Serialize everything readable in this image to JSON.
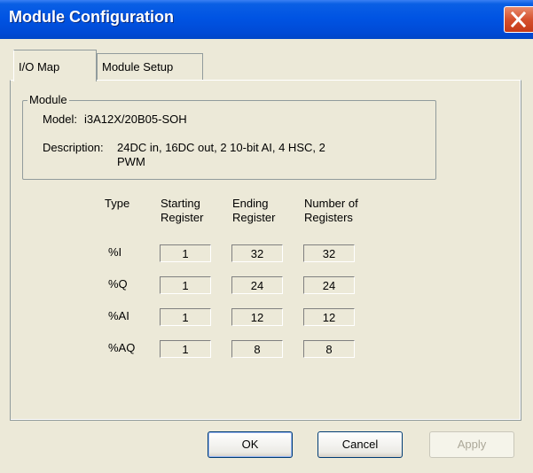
{
  "window": {
    "title": "Module Configuration"
  },
  "tabs": [
    {
      "label": "I/O Map",
      "active": true
    },
    {
      "label": "Module Setup",
      "active": false
    }
  ],
  "module_group": {
    "label": "Module",
    "model_label": "Model:",
    "model_value": "i3A12X/20B05-SOH",
    "description_label": "Description:",
    "description_line1": "24DC in, 16DC out, 2 10-bit AI, 4 HSC, 2",
    "description_line2": "PWM"
  },
  "register_table": {
    "headers": {
      "type": "Type",
      "starting_1": "Starting",
      "starting_2": "Register",
      "ending_1": "Ending",
      "ending_2": "Register",
      "count_1": "Number of",
      "count_2": "Registers"
    },
    "rows": [
      {
        "type": "%I",
        "start": "1",
        "end": "32",
        "count": "32"
      },
      {
        "type": "%Q",
        "start": "1",
        "end": "24",
        "count": "24"
      },
      {
        "type": "%AI",
        "start": "1",
        "end": "12",
        "count": "12"
      },
      {
        "type": "%AQ",
        "start": "1",
        "end": "8",
        "count": "8"
      }
    ]
  },
  "buttons": {
    "ok": "OK",
    "cancel": "Cancel",
    "apply": "Apply"
  },
  "icons": {
    "close": "close-icon"
  },
  "colors": {
    "titlebar": "#0054E3",
    "close": "#D5512E",
    "background": "#ECE9D8"
  }
}
